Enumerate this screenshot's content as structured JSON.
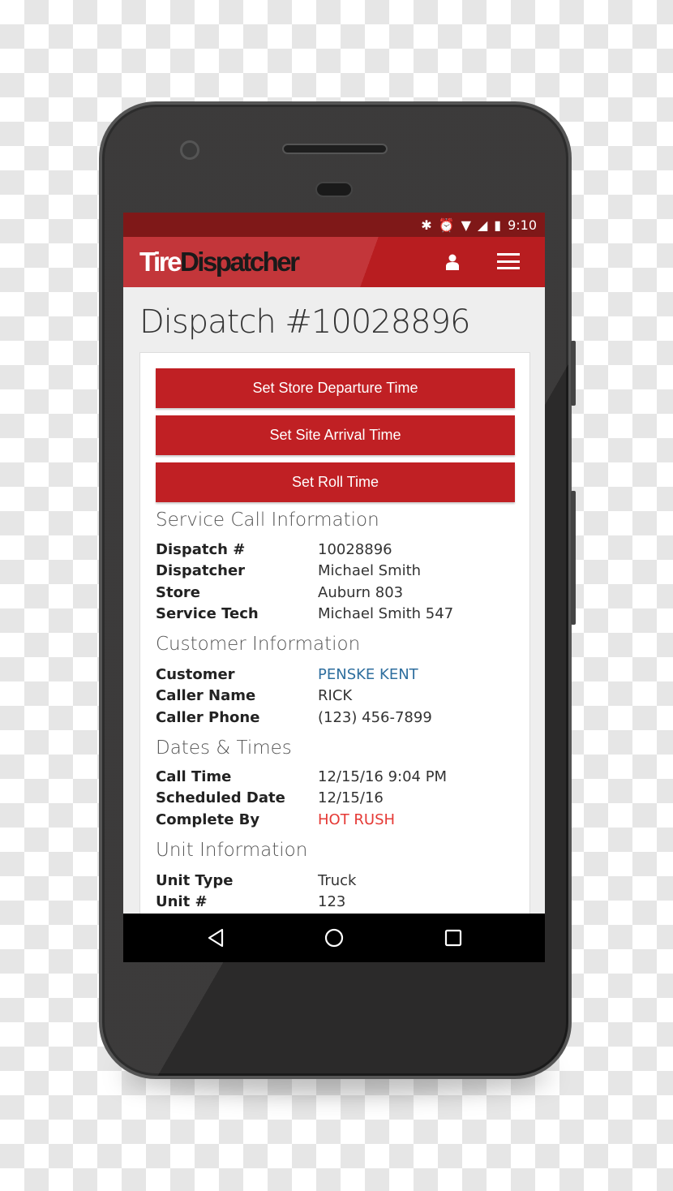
{
  "status": {
    "time": "9:10",
    "icons": [
      "bluetooth-icon",
      "alarm-icon",
      "wifi-icon",
      "signal-icon",
      "battery-charging-icon"
    ]
  },
  "appbar": {
    "logo_part1": "Tire",
    "logo_part2": "Dispatcher",
    "brand_color": "#c02024"
  },
  "page_title": "Dispatch #10028896",
  "actions": [
    "Set Store Departure Time",
    "Set Site Arrival Time",
    "Set Roll Time"
  ],
  "sections": [
    {
      "heading": "Service Call Information",
      "rows": [
        {
          "label": "Dispatch #",
          "value": "10028896"
        },
        {
          "label": "Dispatcher",
          "value": "Michael Smith"
        },
        {
          "label": "Store",
          "value": "Auburn 803"
        },
        {
          "label": "Service Tech",
          "value": "Michael Smith 547"
        }
      ]
    },
    {
      "heading": "Customer Information",
      "rows": [
        {
          "label": "Customer",
          "value": "PENSKE KENT",
          "color": "#2e6e9e"
        },
        {
          "label": "Caller Name",
          "value": "RICK"
        },
        {
          "label": "Caller Phone",
          "value": "(123) 456-7899"
        }
      ]
    },
    {
      "heading": "Dates & Times",
      "rows": [
        {
          "label": "Call Time",
          "value": "12/15/16 9:04 PM"
        },
        {
          "label": "Scheduled Date",
          "value": "12/15/16"
        },
        {
          "label": "Complete By",
          "value": "HOT RUSH",
          "color": "#e53935"
        }
      ]
    },
    {
      "heading": "Unit Information",
      "rows": [
        {
          "label": "Unit Type",
          "value": "Truck"
        },
        {
          "label": "Unit #",
          "value": "123"
        }
      ]
    }
  ]
}
